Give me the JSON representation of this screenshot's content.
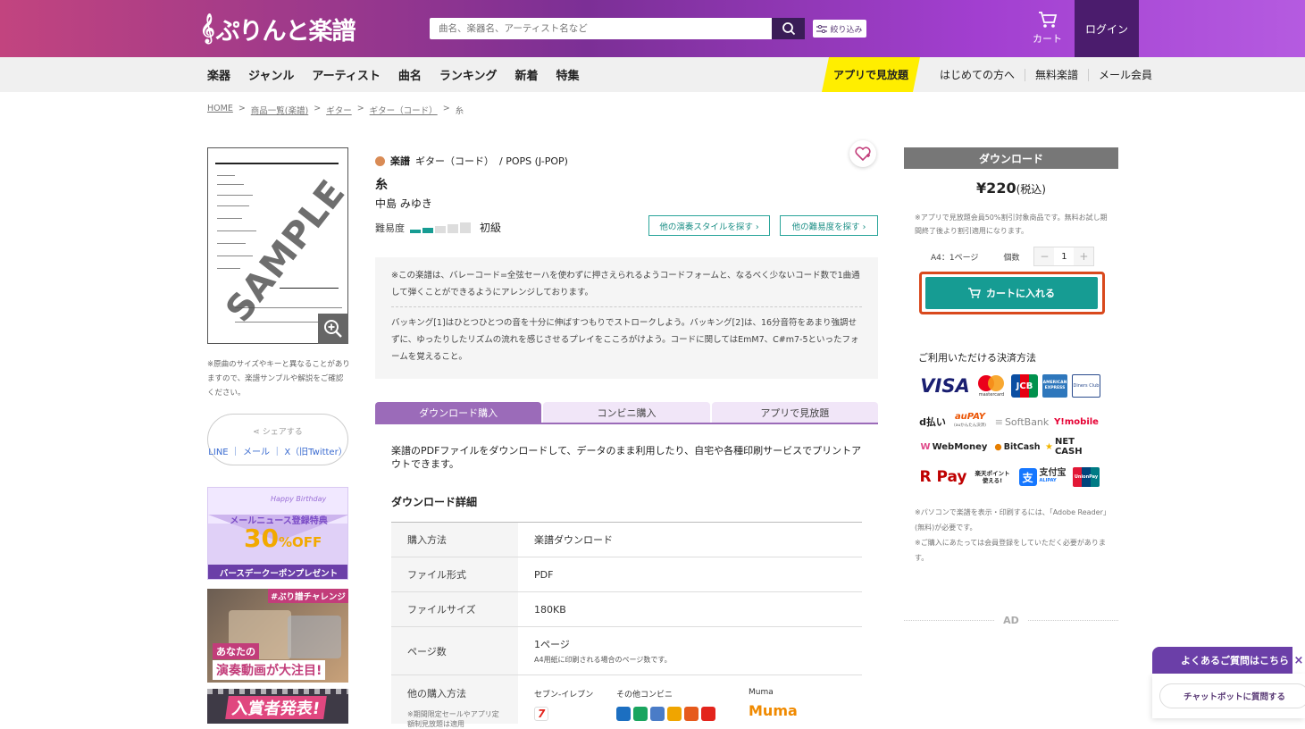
{
  "header": {
    "logo_text": "ぷりんと楽譜",
    "search_placeholder": "曲名、楽器名、アーティスト名など",
    "filter_label": "絞り込み",
    "cart_label": "カート",
    "login_label": "ログイン"
  },
  "nav": {
    "main": [
      "楽器",
      "ジャンル",
      "アーティスト",
      "曲名",
      "ランキング",
      "新着",
      "特集"
    ],
    "app_badge": "アプリで見放題",
    "right": [
      "はじめての方へ",
      "無料楽譜",
      "メール会員"
    ]
  },
  "breadcrumb": [
    "HOME",
    "商品一覧(楽譜)",
    "ギター",
    "ギター（コード）",
    "糸"
  ],
  "preview": {
    "sample_label": "SAMPLE",
    "note": "※原曲のサイズやキーと異なることがありますので、楽譜サンプルや解説をご確認ください。"
  },
  "share": {
    "title": "シェアする",
    "links": "LINE ｜ メール ｜ X（旧Twitter）"
  },
  "banners": {
    "b1_line1": "Happy Birthday",
    "b1_line2": "メールニュース登録特典",
    "b1_pct": "30",
    "b1_off": "%OFF",
    "b1_line3": "バースデークーポンプレゼント",
    "b2_tag": "#ぷり譜チャレンジ",
    "b2_line1": "あなたの",
    "b2_line2": "演奏動画が大注目!",
    "b3_text": "入賞者発表!"
  },
  "product": {
    "category_main": "楽譜",
    "category_sub": "ギター（コード）",
    "genre": "/ POPS (J-POP)",
    "title": "糸",
    "artist": "中島 みゆき",
    "difficulty_label": "難易度",
    "difficulty_level": "初級",
    "difficulty_value": 2,
    "difficulty_max": 5,
    "other_style_btn": "他の演奏スタイルを探す ›",
    "other_level_btn": "他の難易度を探す ›",
    "desc1": "※この楽譜は、バレーコード=全弦セーハを使わずに押さえられるようコードフォームと、なるべく少ないコード数で1曲通して弾くことができるようにアレンジしております。",
    "desc2": "バッキング[1]はひとつひとつの音を十分に伸ばすつもりでストロークしよう。バッキング[2]は、16分音符をあまり強調せずに、ゆったりしたリズムの流れを感じさせるプレイをこころがけよう。コードに関してはEmM7、C#m7-5といったフォームを覚えること。"
  },
  "tabs": [
    "ダウンロード購入",
    "コンビニ購入",
    "アプリで見放題"
  ],
  "tab_desc": "楽譜のPDFファイルをダウンロードして、データのまま利用したり、自宅や各種印刷サービスでプリントアウトできます。",
  "download_detail": {
    "title": "ダウンロード詳細",
    "rows": [
      {
        "k": "購入方法",
        "v": "楽譜ダウンロード",
        "sub": ""
      },
      {
        "k": "ファイル形式",
        "v": "PDF",
        "sub": ""
      },
      {
        "k": "ファイルサイズ",
        "v": "180KB",
        "sub": ""
      },
      {
        "k": "ページ数",
        "v": "1ページ",
        "sub": "A4用紙に印刷される場合のページ数です。"
      }
    ],
    "other_k": "他の購入方法",
    "other_note": "※期間限定セールやアプリ定額制見放題は適用",
    "stores": [
      "セブン-イレブン",
      "その他コンビニ",
      "Muma"
    ],
    "muma_logo": "Muma"
  },
  "purchase": {
    "header": "ダウンロード",
    "price": "¥220",
    "tax": "(税込)",
    "note": "※アプリで見放題会員50%割引対象商品です。無料お試し期間終了後より割引適用になります。",
    "size_label": "A4：1ページ",
    "qty_label": "個数",
    "qty_minus": "−",
    "qty_value": "1",
    "qty_plus": "+",
    "cart_button": "カートに入れる",
    "payment_title": "ご利用いただける決済方法",
    "note2": "※パソコンで楽譜を表示・印刷するには、「Adobe Reader」(無料)が必要です。",
    "note3": "※ご購入にあたっては会員登録をしていただく必要があります。",
    "ad_label": "AD"
  },
  "payments": {
    "visa": "VISA",
    "mastercard": "mastercard",
    "jcb": "JCB",
    "amex": "AMERICAN EXPRESS",
    "diners": "Diners Club",
    "d": "d払い",
    "au": "auPAY",
    "au_sub": "(auかんたん決済)",
    "softbank": "SoftBank",
    "ymobile": "Y!mobile",
    "webmoney": "WebMoney",
    "bitcash": "BitCash",
    "netcash": "NET CASH",
    "rpay": "R Pay",
    "rakuten_point": "楽天ポイント使える!",
    "alipay": "支付宝",
    "alipay_sub": "ALIPAY",
    "unionpay": "UnionPay"
  },
  "faq": {
    "label": "よくあるご質問はこちら",
    "close": "×",
    "chatbot": "チャットボットに質問する"
  },
  "colors": {
    "accent": "#169c93",
    "brand": "#7c2f96",
    "highlight": "#d9491d"
  }
}
